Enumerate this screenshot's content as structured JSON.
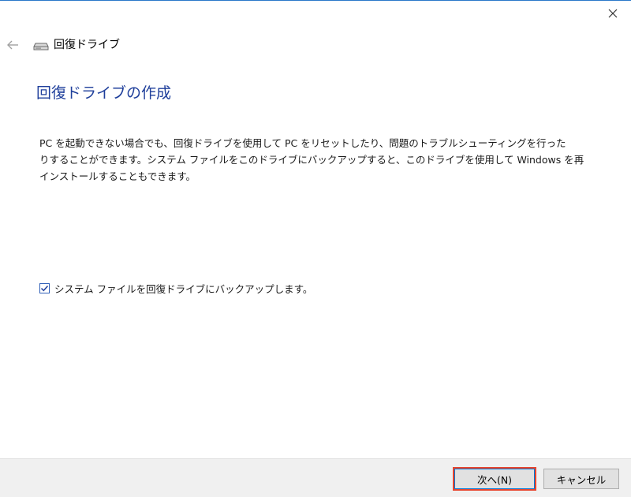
{
  "window": {
    "title": "回復ドライブ",
    "close_icon": "close-icon",
    "back_icon": "back-arrow-icon",
    "drive_icon": "drive-icon"
  },
  "main": {
    "heading": "回復ドライブの作成",
    "description_lines": [
      "PC を起動できない場合でも、回復ドライブを使用して PC をリセットしたり、問題のトラブルシューティングを行った",
      "りすることができます。システム ファイルをこのドライブにバックアップすると、このドライブを使用して Windows を再",
      "インストールすることもできます。"
    ],
    "checkbox": {
      "label": "システム ファイルを回復ドライブにバックアップします。",
      "checked": true
    }
  },
  "footer": {
    "next_label": "次へ(N)",
    "cancel_label": "キャンセル"
  },
  "colors": {
    "heading": "#1f3f9b",
    "accent_border": "#0078d7",
    "highlight": "#e8452e"
  }
}
